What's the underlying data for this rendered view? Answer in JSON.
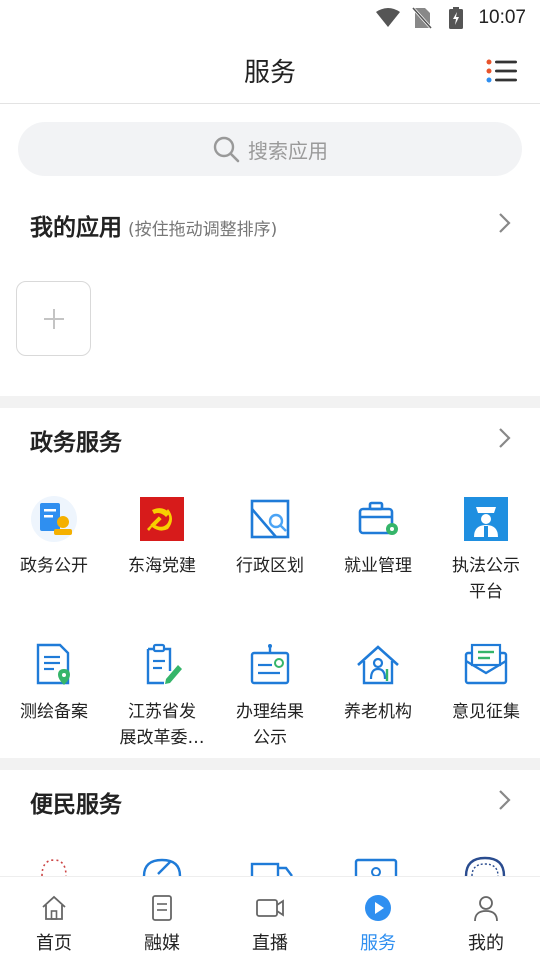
{
  "status_bar": {
    "time": "10:07"
  },
  "header": {
    "title": "服务"
  },
  "search": {
    "placeholder": "搜索应用"
  },
  "my_apps": {
    "title": "我的应用",
    "hint": "(按住拖动调整排序)"
  },
  "gov_services": {
    "title": "政务服务",
    "items": [
      {
        "label": "政务公开"
      },
      {
        "label": "东海党建"
      },
      {
        "label": "行政区划"
      },
      {
        "label": "就业管理"
      },
      {
        "label": "执法公示\n平台"
      },
      {
        "label": "测绘备案"
      },
      {
        "label": "江苏省发\n展改革委…"
      },
      {
        "label": "办理结果\n公示"
      },
      {
        "label": "养老机构"
      },
      {
        "label": "意见征集"
      }
    ]
  },
  "convenience_services": {
    "title": "便民服务"
  },
  "bottom_nav": {
    "items": [
      {
        "label": "首页",
        "icon": "home-icon"
      },
      {
        "label": "融媒",
        "icon": "document-icon"
      },
      {
        "label": "直播",
        "icon": "video-camera-icon"
      },
      {
        "label": "服务",
        "icon": "play-circle-icon",
        "active": true
      },
      {
        "label": "我的",
        "icon": "person-icon"
      }
    ]
  },
  "colors": {
    "accent": "#2f8ff0",
    "icon_blue": "#1f7bd8",
    "party_red": "#d71b1b"
  }
}
